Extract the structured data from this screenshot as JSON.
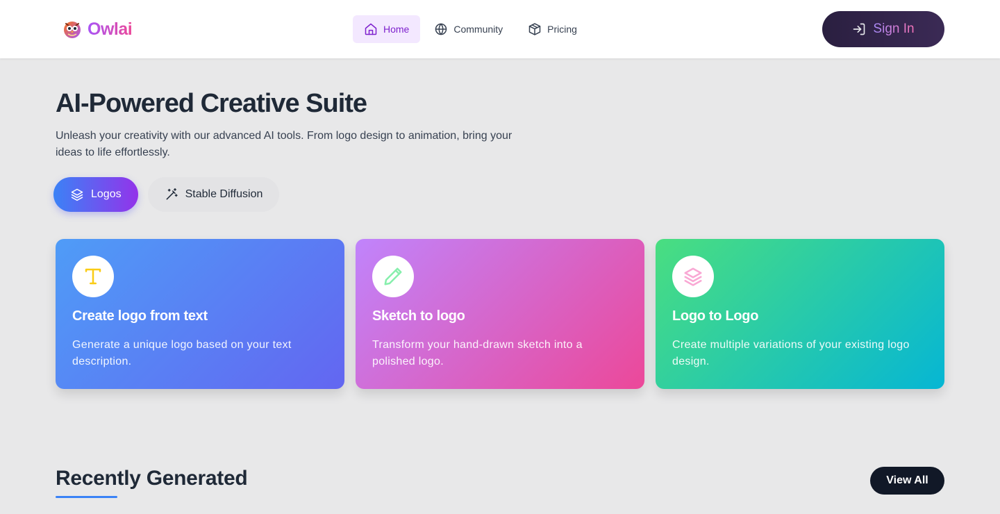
{
  "header": {
    "brand_name": "Owlai",
    "nav": [
      {
        "label": "Home",
        "icon": "home-icon",
        "active": true
      },
      {
        "label": "Community",
        "icon": "globe-icon",
        "active": false
      },
      {
        "label": "Pricing",
        "icon": "box-icon",
        "active": false
      }
    ],
    "signin_label": "Sign In"
  },
  "hero": {
    "title": "AI-Powered Creative Suite",
    "subtitle": "Unleash your creativity with our advanced AI tools. From logo design to animation, bring your ideas to life effortlessly."
  },
  "tabs": [
    {
      "label": "Logos",
      "icon": "layers-icon",
      "active": true
    },
    {
      "label": "Stable Diffusion",
      "icon": "magic-wand-icon",
      "active": false
    }
  ],
  "cards": [
    {
      "title": "Create logo from text",
      "description": "Generate a unique logo based on your text description.",
      "icon": "text-t-icon",
      "icon_color": "#facc15"
    },
    {
      "title": "Sketch to logo",
      "description": "Transform your hand-drawn sketch into a polished logo.",
      "icon": "pencil-icon",
      "icon_color": "#86efac"
    },
    {
      "title": "Logo to Logo",
      "description": "Create multiple variations of your existing logo design.",
      "icon": "layers-icon",
      "icon_color": "#f9a8d4"
    }
  ],
  "recent": {
    "title": "Recently Generated",
    "view_all_label": "View All"
  },
  "colors": {
    "accent": "#9333ea",
    "brand_gradient_start": "#a855f7",
    "brand_gradient_end": "#ec4899",
    "underline": "#3b82f6"
  }
}
